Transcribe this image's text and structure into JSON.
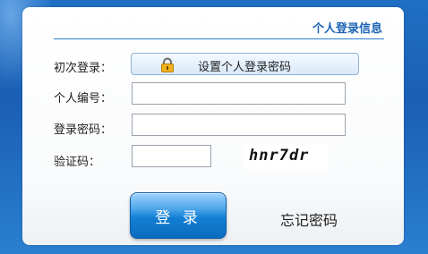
{
  "panel": {
    "title": "个人登录信息"
  },
  "form": {
    "first_login_label": "初次登录：",
    "set_password_button": "设置个人登录密码",
    "personal_id_label": "个人编号：",
    "personal_id_value": "",
    "password_label": "登录密码：",
    "password_value": "",
    "captcha_label": "验证码：",
    "captcha_value": "",
    "captcha_image_text": "hnr7dr"
  },
  "actions": {
    "login_button": "登 录",
    "forgot_password": "忘记密码"
  },
  "icons": {
    "set_password": "lock-icon"
  },
  "colors": {
    "background": "#1f6fc4",
    "accent": "#1b64b5",
    "login_button": "#137fd4"
  }
}
